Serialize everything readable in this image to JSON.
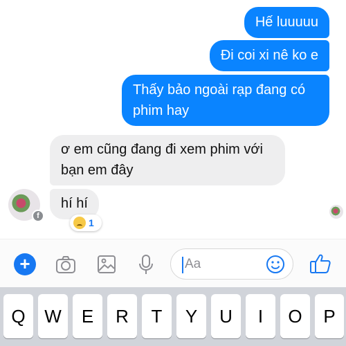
{
  "messages": [
    {
      "side": "out",
      "text": "Hế luuuuu"
    },
    {
      "side": "out",
      "text": "Đi coi xi nê ko e"
    },
    {
      "side": "out",
      "text_line1": "Thấy bảo ngoài rạp đang có",
      "text_line2": "phim hay"
    },
    {
      "side": "in",
      "text_line1": "ơ em cũng đang đi xem phim với",
      "text_line2": "bạn em đây"
    },
    {
      "side": "in",
      "text": "hí hí"
    }
  ],
  "reaction": {
    "emoji": "sad-face-icon",
    "count": "1"
  },
  "composer": {
    "placeholder": "Aa"
  },
  "keyboard": {
    "row1": [
      "Q",
      "W",
      "E",
      "R",
      "T",
      "Y",
      "U",
      "I",
      "O",
      "P"
    ]
  },
  "colors": {
    "accent": "#1778f2",
    "outgoing_bubble": "#0a84ff",
    "incoming_bubble": "#eeeeef"
  }
}
